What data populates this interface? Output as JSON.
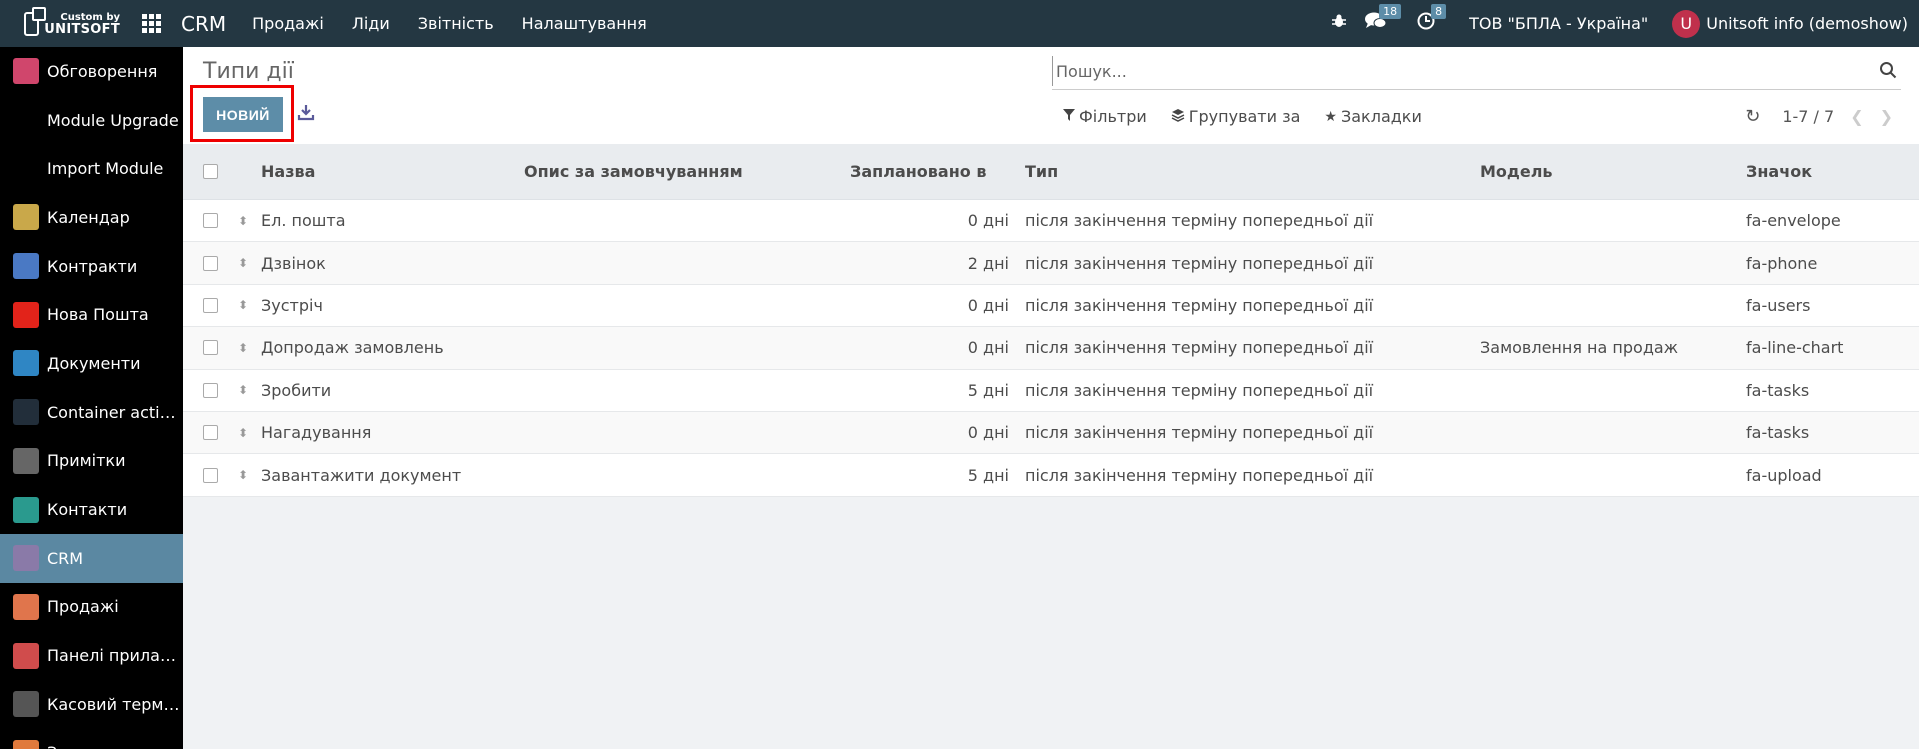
{
  "topbar": {
    "logo_small": "Custom by",
    "logo_big": "UNITSOFT",
    "app_title": "CRM",
    "menu": [
      "Продажі",
      "Ліди",
      "Звітність",
      "Налаштування"
    ],
    "messages_count": "18",
    "activities_count": "8",
    "company": "ТОВ \"БПЛА - Україна\"",
    "avatar_letter": "U",
    "user": "Unitsoft info (demoshow)"
  },
  "sidebar": {
    "items": [
      {
        "label": "Обговорення",
        "icon": "chat-icon",
        "color": "#d0466c"
      },
      {
        "label": "Module Upgrade",
        "icon": "blank",
        "color": ""
      },
      {
        "label": "Import Module",
        "icon": "blank",
        "color": ""
      },
      {
        "label": "Календар",
        "icon": "calendar-icon",
        "color": "#c9a84a"
      },
      {
        "label": "Контракти",
        "icon": "contract-icon",
        "color": "#4a79c4"
      },
      {
        "label": "Нова Пошта",
        "icon": "novaposhta-icon",
        "color": "#e2231a"
      },
      {
        "label": "Документи",
        "icon": "documents-icon",
        "color": "#2f86c4"
      },
      {
        "label": "Container actions",
        "icon": "container-icon",
        "color": "#222e3a"
      },
      {
        "label": "Примітки",
        "icon": "notes-icon",
        "color": "#666666"
      },
      {
        "label": "Контакти",
        "icon": "contacts-icon",
        "color": "#2a9a8e"
      },
      {
        "label": "CRM",
        "icon": "crm-icon",
        "color": "#8a7aa8"
      },
      {
        "label": "Продажі",
        "icon": "sales-icon",
        "color": "#e0754c"
      },
      {
        "label": "Панелі приладів",
        "icon": "dashboard-icon",
        "color": "#d04c4c"
      },
      {
        "label": "Касовий термін...",
        "icon": "pos-icon",
        "color": "#555555"
      },
      {
        "label": "З...",
        "icon": "purchase-icon",
        "color": "#e07a3c"
      }
    ],
    "active_index": 10
  },
  "control": {
    "breadcrumb": "Типи дії",
    "new_button": "НОВИЙ",
    "search_placeholder": "Пошук...",
    "filters": "Фільтри",
    "group_by": "Групувати за",
    "favorites": "Закладки",
    "pager": "1-7 / 7"
  },
  "table": {
    "headers": {
      "name": "Назва",
      "description": "Опис за замовчуванням",
      "delay": "Заплановано в",
      "type": "Тип",
      "model": "Модель",
      "icon": "Значок"
    },
    "rows": [
      {
        "name": "Ел. пошта",
        "description": "",
        "delay": "0 дні",
        "type": "після закінчення терміну попередньої дії",
        "model": "",
        "icon": "fa-envelope"
      },
      {
        "name": "Дзвінок",
        "description": "",
        "delay": "2 дні",
        "type": "після закінчення терміну попередньої дії",
        "model": "",
        "icon": "fa-phone"
      },
      {
        "name": "Зустріч",
        "description": "",
        "delay": "0 дні",
        "type": "після закінчення терміну попередньої дії",
        "model": "",
        "icon": "fa-users"
      },
      {
        "name": "Допродаж замовлень",
        "description": "",
        "delay": "0 дні",
        "type": "після закінчення терміну попередньої дії",
        "model": "Замовлення на продаж",
        "icon": "fa-line-chart"
      },
      {
        "name": "Зробити",
        "description": "",
        "delay": "5 дні",
        "type": "після закінчення терміну попередньої дії",
        "model": "",
        "icon": "fa-tasks"
      },
      {
        "name": "Нагадування",
        "description": "",
        "delay": "0 дні",
        "type": "після закінчення терміну попередньої дії",
        "model": "",
        "icon": "fa-tasks"
      },
      {
        "name": "Завантажити документ",
        "description": "",
        "delay": "5 дні",
        "type": "після закінчення терміну попередньої дії",
        "model": "",
        "icon": "fa-upload"
      }
    ]
  },
  "colors": {
    "topbar": "#243742",
    "accent": "#5d8da8",
    "highlight": "#ee0000"
  }
}
